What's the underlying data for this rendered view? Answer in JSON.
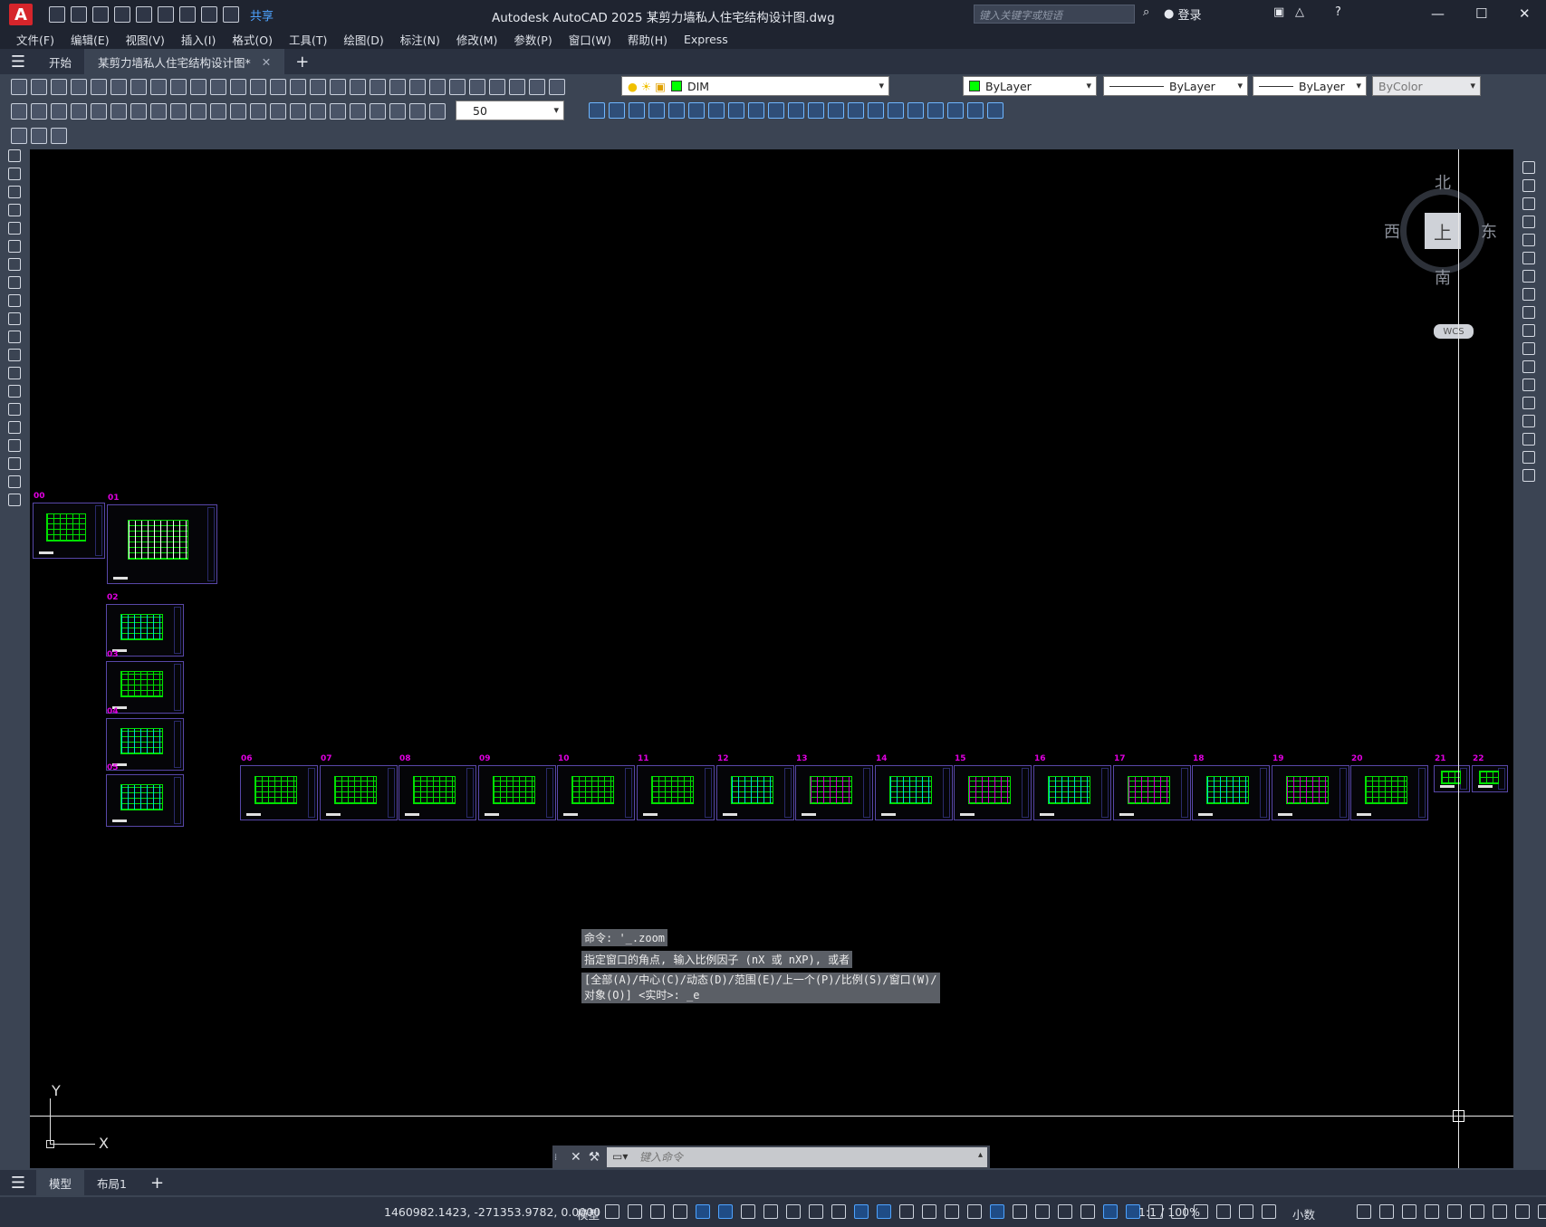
{
  "titlebar": {
    "app_logo": "A",
    "share_label": "共享",
    "title": "Autodesk AutoCAD 2025    某剪力墙私人住宅结构设计图.dwg",
    "search_placeholder": "键入关键字或短语",
    "login_label": "登录",
    "help_label": "?"
  },
  "menu": [
    "文件(F)",
    "编辑(E)",
    "视图(V)",
    "插入(I)",
    "格式(O)",
    "工具(T)",
    "绘图(D)",
    "标注(N)",
    "修改(M)",
    "参数(P)",
    "窗口(W)",
    "帮助(H)",
    "Express"
  ],
  "file_tabs": [
    {
      "label": "开始"
    },
    {
      "label": "某剪力墙私人住宅结构设计图*"
    }
  ],
  "properties": {
    "layer": "DIM",
    "layer_color": "#00ff00",
    "color": "ByLayer",
    "linetype": "ByLayer",
    "lineweight": "ByLayer",
    "plotstyle": "ByColor",
    "dimscale": "50"
  },
  "viewcube": {
    "north": "北",
    "south": "南",
    "east": "东",
    "west": "西",
    "face": "上",
    "wcs": "WCS"
  },
  "ucs": {
    "x": "X",
    "y": "Y"
  },
  "command": {
    "history_line1": "命令: '_.zoom",
    "history_line2": "指定窗口的角点, 输入比例因子 (nX 或 nXP), 或者",
    "history_line3": "[全部(A)/中心(C)/动态(D)/范围(E)/上一个(P)/比例(S)/窗口(W)/",
    "history_line4": "对象(O)] <实时>: _e",
    "input_placeholder": "键入命令"
  },
  "layout_tabs": [
    {
      "label": "模型"
    },
    {
      "label": "布局1"
    }
  ],
  "status": {
    "coords": "1460982.1423, -271353.9782, 0.0000",
    "model": "模型",
    "scale": "1:1 / 100%",
    "units": "小数"
  },
  "sheets": {
    "cover": [
      "00",
      "01"
    ],
    "column": [
      "02",
      "03",
      "04",
      "05"
    ],
    "row": [
      "06",
      "07",
      "08",
      "09",
      "10",
      "11",
      "12",
      "13",
      "14",
      "15",
      "16",
      "17",
      "18",
      "19",
      "20",
      "21",
      "22"
    ]
  },
  "colors": {
    "canvas": "#000000",
    "sheet_border": "#5847a8",
    "plan_green": "#00e000",
    "plan_magenta": "#d000d0",
    "plan_cyan": "#00d8d8",
    "sheet_number": "#e000e0"
  }
}
